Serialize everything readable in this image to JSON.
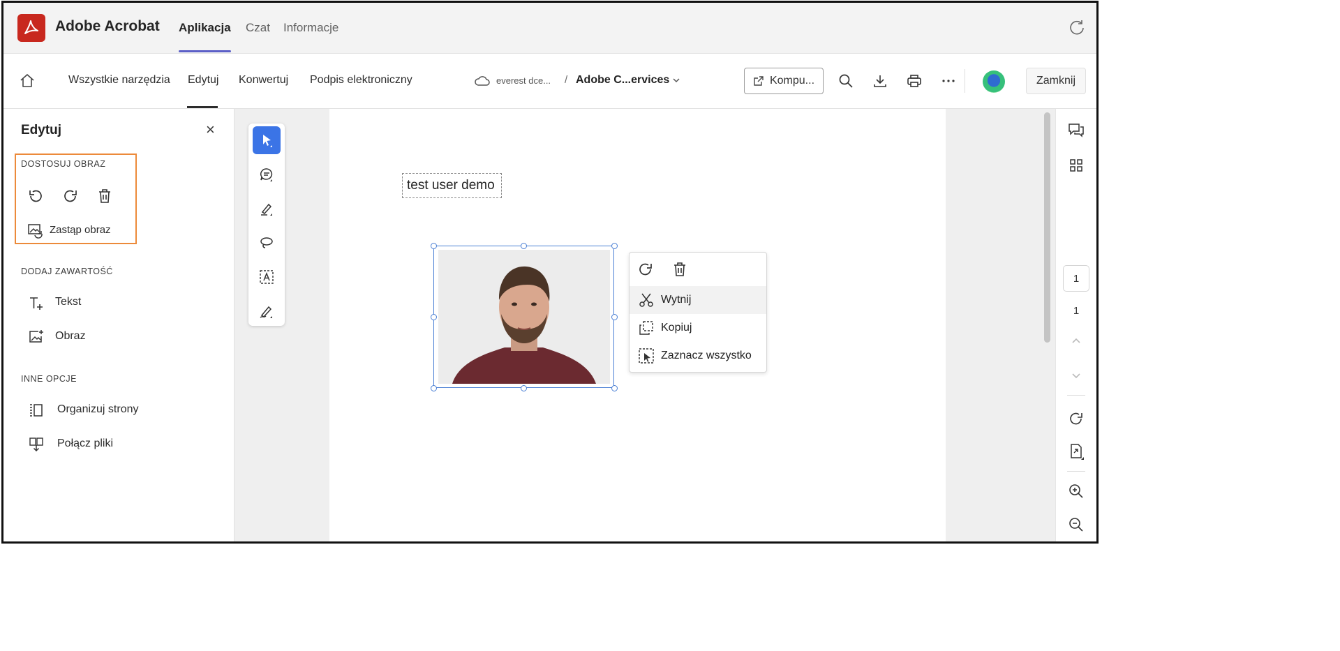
{
  "app": {
    "title": "Adobe Acrobat",
    "tabs": [
      {
        "label": "Aplikacja",
        "active": true
      },
      {
        "label": "Czat",
        "active": false
      },
      {
        "label": "Informacje",
        "active": false
      }
    ]
  },
  "toolbar": {
    "items": [
      {
        "label": "Wszystkie narzędzia"
      },
      {
        "label": "Edytuj",
        "active": true
      },
      {
        "label": "Konwertuj"
      },
      {
        "label": "Podpis elektroniczny"
      }
    ],
    "breadcrumb_location": "everest dce...",
    "breadcrumb_separator": "/",
    "document_name": "Adobe C...ervices",
    "open_button_label": "Kompu...",
    "close_button_label": "Zamknij"
  },
  "left_panel": {
    "title": "Edytuj",
    "close_glyph": "×",
    "sections": {
      "adjust_image": {
        "label": "DOSTOSUJ OBRAZ",
        "replace_label": "Zastąp obraz"
      },
      "add_content": {
        "label": "DODAJ ZAWARTOŚĆ",
        "text_label": "Tekst",
        "image_label": "Obraz"
      },
      "other_options": {
        "label": "INNE OPCJE",
        "organize_label": "Organizuj strony",
        "merge_label": "Połącz pliki"
      }
    }
  },
  "document": {
    "text_box": "test user demo"
  },
  "context_menu": {
    "cut": "Wytnij",
    "copy": "Kopiuj",
    "select_all": "Zaznacz wszystko"
  },
  "page_nav": {
    "current": "1",
    "total": "1"
  },
  "colors": {
    "brand_red": "#c8281e",
    "accent_purple": "#5b5fc7",
    "tool_active_blue": "#3b74e6",
    "highlight_orange": "#ec8a3a",
    "selection_blue": "#4a7fd4"
  },
  "icons": [
    "acrobat-logo-icon",
    "refresh-icon",
    "home-icon",
    "cloud-icon",
    "chevron-down-icon",
    "open-external-icon",
    "search-icon",
    "download-icon",
    "print-icon",
    "more-icon",
    "avatar",
    "undo-icon",
    "redo-icon",
    "trash-icon",
    "replace-image-icon",
    "add-text-icon",
    "add-image-icon",
    "organize-pages-icon",
    "merge-files-icon",
    "select-tool-icon",
    "comment-tool-icon",
    "highlight-tool-icon",
    "lasso-tool-icon",
    "text-recognition-tool-icon",
    "sign-tool-icon",
    "rotate-icon",
    "cut-icon",
    "copy-icon",
    "select-all-icon",
    "comments-icon",
    "grid-icon",
    "chevron-up-icon",
    "page-export-icon",
    "zoom-in-icon",
    "zoom-out-icon"
  ]
}
